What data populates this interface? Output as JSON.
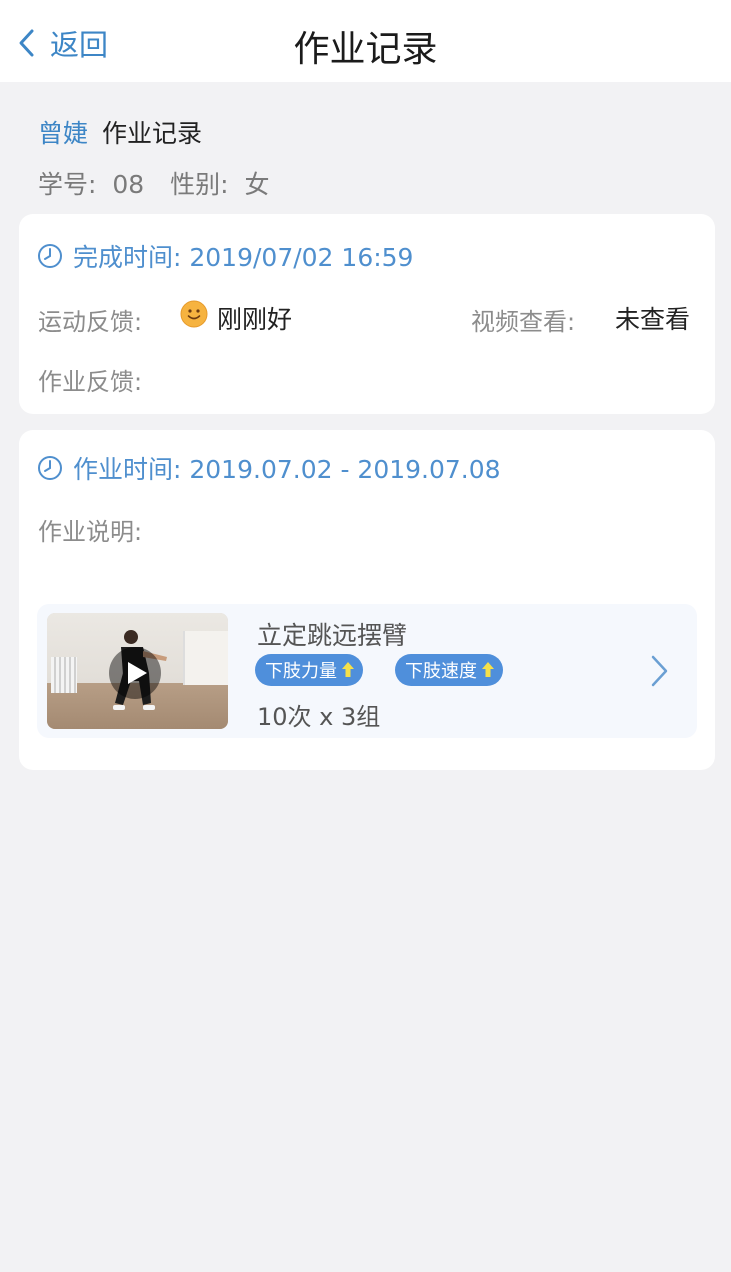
{
  "nav": {
    "back_label": "返回",
    "title": "作业记录"
  },
  "student": {
    "name": "曾婕",
    "record_title": "作业记录",
    "id_label": "学号:",
    "id_value": "08",
    "gender_label": "性别:",
    "gender_value": "女"
  },
  "completion": {
    "time_text": "完成时间: 2019/07/02 16:59",
    "exercise_feedback_label": "运动反馈:",
    "exercise_feedback_icon": "smiley-face-icon",
    "exercise_feedback_value": "刚刚好",
    "video_view_label": "视频查看:",
    "video_view_value": "未查看",
    "homework_feedback_label": "作业反馈:",
    "homework_feedback_value": ""
  },
  "assignment": {
    "time_text": "作业时间: 2019.07.02 - 2019.07.08",
    "description_label": "作业说明:",
    "description_value": "",
    "exercises": [
      {
        "name": "立定跳远摆臂",
        "tags": [
          {
            "label": "下肢力量",
            "icon": "arrow-up-icon"
          },
          {
            "label": "下肢速度",
            "icon": "arrow-up-icon"
          }
        ],
        "reps": "10次 x 3组"
      }
    ]
  },
  "colors": {
    "accent": "#3d86c6",
    "tag_bg": "#4f8fdb",
    "tag_arrow": "#f5e04a",
    "background": "#f2f2f4"
  }
}
